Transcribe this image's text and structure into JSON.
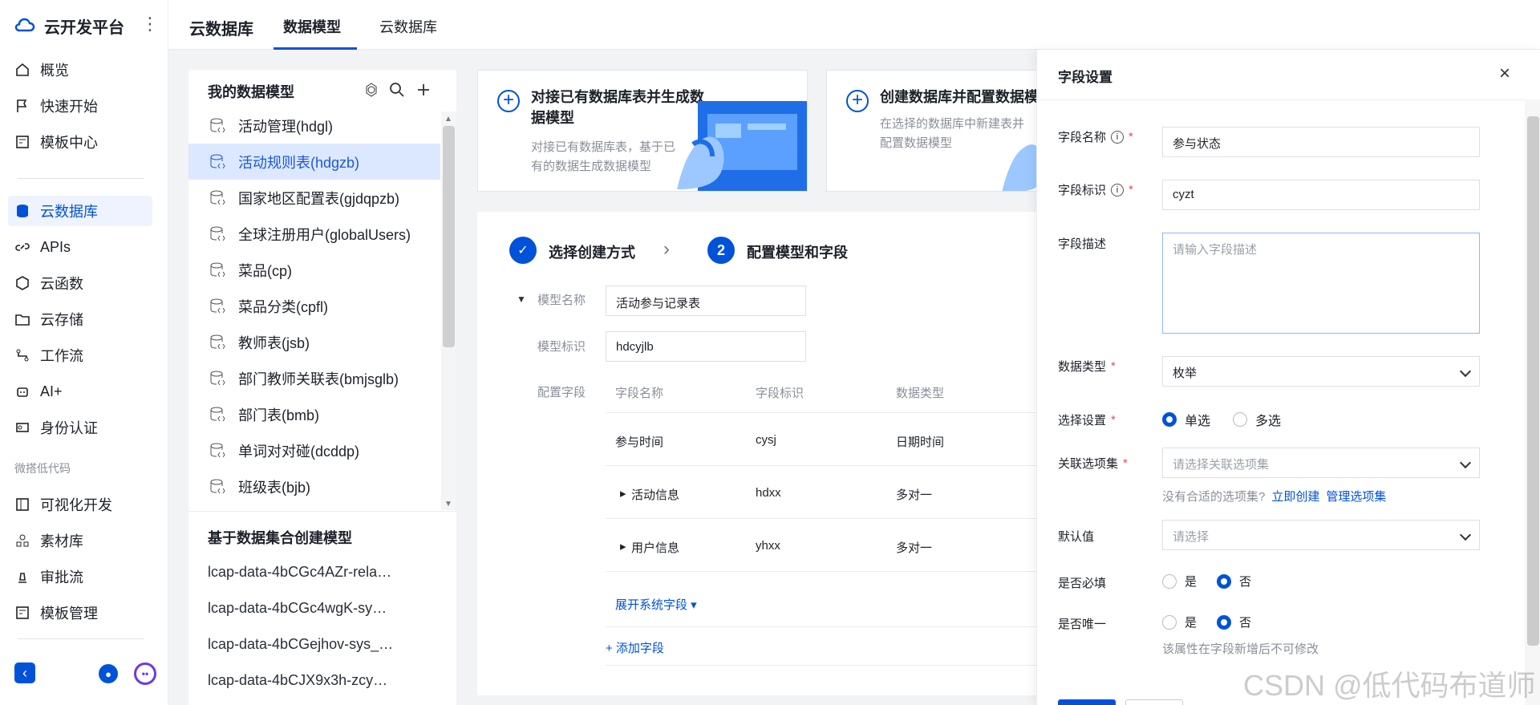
{
  "brand": {
    "name": "云开发平台"
  },
  "nav": {
    "items": [
      {
        "label": "概览",
        "icon": "home-icon"
      },
      {
        "label": "快速开始",
        "icon": "flag-icon"
      },
      {
        "label": "模板中心",
        "icon": "template-icon"
      },
      {
        "label": "云数据库",
        "icon": "database-icon"
      },
      {
        "label": "APIs",
        "icon": "link-icon"
      },
      {
        "label": "云函数",
        "icon": "function-icon"
      },
      {
        "label": "云存储",
        "icon": "folder-icon"
      },
      {
        "label": "工作流",
        "icon": "workflow-icon"
      },
      {
        "label": "AI+",
        "icon": "robot-icon"
      },
      {
        "label": "身份认证",
        "icon": "id-card-icon"
      },
      {
        "label": "可视化开发",
        "icon": "visual-dev-icon"
      },
      {
        "label": "素材库",
        "icon": "assets-icon"
      },
      {
        "label": "审批流",
        "icon": "approval-icon"
      },
      {
        "label": "模板管理",
        "icon": "template-manage-icon"
      }
    ],
    "group_label": "微搭低代码"
  },
  "top": {
    "title": "云数据库",
    "tabs": [
      "数据模型",
      "云数据库"
    ]
  },
  "models": {
    "title": "我的数据模型",
    "items": [
      "活动管理(hdgl)",
      "活动规则表(hdgzb)",
      "国家地区配置表(gjdqpzb)",
      "全球注册用户(globalUsers)",
      "菜品(cp)",
      "菜品分类(cpfl)",
      "教师表(jsb)",
      "部门教师关联表(bmjsglb)",
      "部门表(bmb)",
      "单词对对碰(dcddp)",
      "班级表(bjb)"
    ]
  },
  "collections": {
    "title": "基于数据集合创建模型",
    "items": [
      "lcap-data-4bCGc4AZr-rela…",
      "lcap-data-4bCGc4wgK-sy…",
      "lcap-data-4bCGejhov-sys_…",
      "lcap-data-4bCJX9x3h-zcy…"
    ]
  },
  "cards": [
    {
      "title": "对接已有数据库表并生成数据模型",
      "desc": "对接已有数据库表，基于已有的数据生成数据模型"
    },
    {
      "title": "创建数据库并配置数据模",
      "desc": "在选择的数据库中新建表并配置数据模型"
    }
  ],
  "wizard": {
    "step1": "选择创建方式",
    "step2_num": "2",
    "step2": "配置模型和字段",
    "model_name_label": "模型名称",
    "model_name_value": "活动参与记录表",
    "model_id_label": "模型标识",
    "model_id_value": "hdcyjlb",
    "fields_label": "配置字段",
    "columns": [
      "字段名称",
      "字段标识",
      "数据类型"
    ],
    "rows": [
      {
        "name": "参与时间",
        "id": "cysj",
        "type": "日期时间"
      },
      {
        "name": "活动信息",
        "id": "hdxx",
        "type": "多对一"
      },
      {
        "name": "用户信息",
        "id": "yhxx",
        "type": "多对一"
      }
    ],
    "expand_system": "展开系统字段 ▾",
    "add_field": "+ 添加字段"
  },
  "drawer": {
    "title": "字段设置",
    "fields": {
      "name_label": "字段名称",
      "name_value": "参与状态",
      "id_label": "字段标识",
      "id_value": "cyzt",
      "desc_label": "字段描述",
      "desc_placeholder": "请输入字段描述",
      "type_label": "数据类型",
      "type_value": "枚举",
      "choice_label": "选择设置",
      "single": "单选",
      "multiple": "多选",
      "option_set_label": "关联选项集",
      "option_set_placeholder": "请选择关联选项集",
      "no_set_hint": "没有合适的选项集?",
      "create_now": "立即创建",
      "manage_set": "管理选项集",
      "default_label": "默认值",
      "default_placeholder": "请选择",
      "required_label": "是否必填",
      "unique_label": "是否唯一",
      "yes": "是",
      "no": "否",
      "unique_hint": "该属性在字段新增后不可修改"
    }
  },
  "watermark": "CSDN @低代码布道师",
  "colors": {
    "accent": "#0052d9",
    "selected": "#dbe8ff",
    "required": "#e34d59"
  }
}
